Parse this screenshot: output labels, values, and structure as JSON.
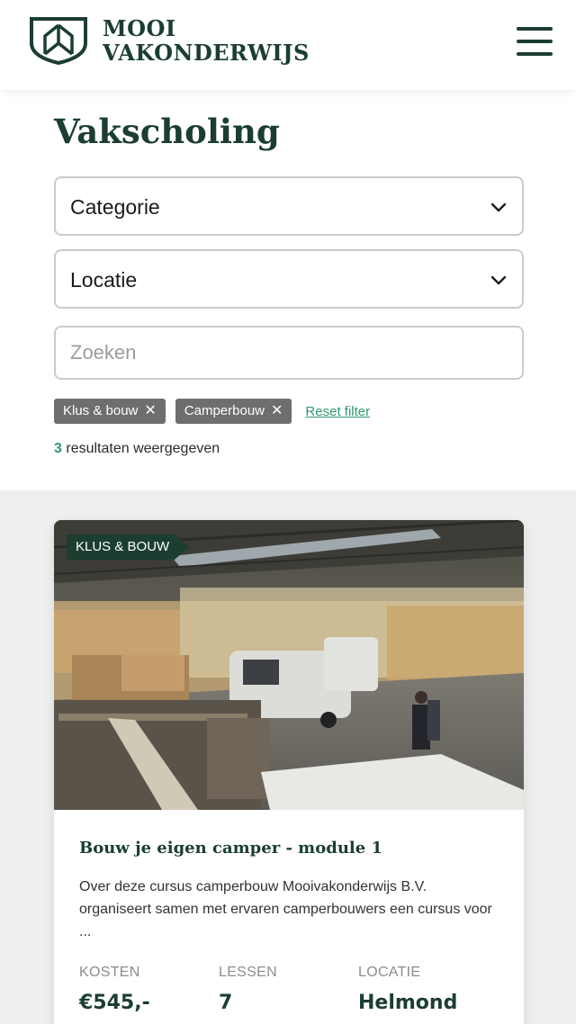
{
  "header": {
    "logo_line1": "MOOI",
    "logo_line2": "VAKONDERWIJS",
    "logo_icon": "shield-icon",
    "menu_icon": "hamburger-icon"
  },
  "page": {
    "title": "Vakscholing"
  },
  "filters": {
    "category_label": "Categorie",
    "location_label": "Locatie",
    "search_placeholder": "Zoeken",
    "chips": [
      "Klus & bouw",
      "Camperbouw"
    ],
    "chip_remove_glyph": "✕",
    "reset_label": "Reset filter",
    "results_count": "3",
    "results_text": "resultaten weergegeven"
  },
  "card": {
    "tag": "KLUS & BOUW",
    "title": "Bouw je eigen camper - module 1",
    "description": "Over deze cursus camperbouw Mooivakonderwijs B.V. organiseert samen met ervaren camperbouwers een cursus voor ...",
    "meta": [
      {
        "label": "KOSTEN",
        "value": "€545,-"
      },
      {
        "label": "LESSEN",
        "value": "7"
      },
      {
        "label": "LOCATIE",
        "value": "Helmond"
      }
    ]
  },
  "colors": {
    "brand_green": "#1b3e31",
    "accent_green": "#2f9a6e",
    "chip_gray": "#6c6f6d",
    "background_gray": "#eef0ef"
  }
}
